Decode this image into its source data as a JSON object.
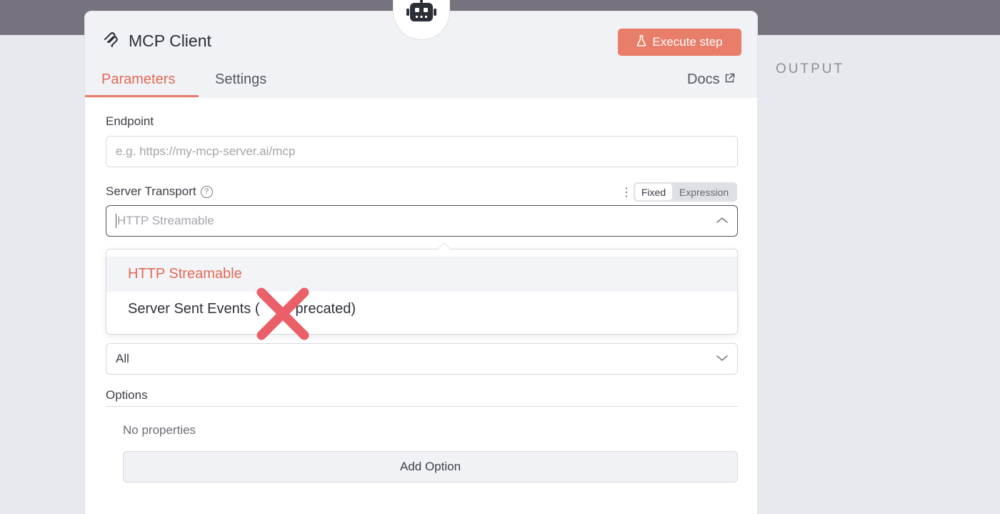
{
  "node": {
    "title": "MCP Client",
    "execute_label": "Execute step",
    "tabs": [
      "Parameters",
      "Settings"
    ],
    "docs_label": "Docs"
  },
  "output_label": "OUTPUT",
  "endpoint": {
    "label": "Endpoint",
    "value": "",
    "placeholder": "e.g. https://my-mcp-server.ai/mcp"
  },
  "server_transport": {
    "label": "Server Transport",
    "mode_fixed": "Fixed",
    "mode_expression": "Expression",
    "value": "HTTP Streamable",
    "options": [
      "HTTP Streamable",
      "Server Sent Events (Deprecated)"
    ],
    "dropdown_visible_texts": [
      "HTTP Streamable",
      "Server Sent Events (",
      "precated)"
    ]
  },
  "tools_select": {
    "value": "All"
  },
  "options_section": {
    "label": "Options",
    "empty_text": "No properties",
    "add_label": "Add Option"
  },
  "colors": {
    "accent": "#e87d69",
    "accent_text": "#e16a55",
    "x_mark": "#ea5f68",
    "top_strip": "#76737f"
  },
  "icons": {
    "node": "mcp-logo-icon",
    "badge": "robot-icon",
    "execute": "flask-icon",
    "docs": "external-link-icon",
    "help": "question-circle-icon",
    "more": "more-vertical-icon",
    "select_open": "chevron-up-icon",
    "select_closed": "chevron-down-icon",
    "overlay": "x-mark-icon"
  }
}
